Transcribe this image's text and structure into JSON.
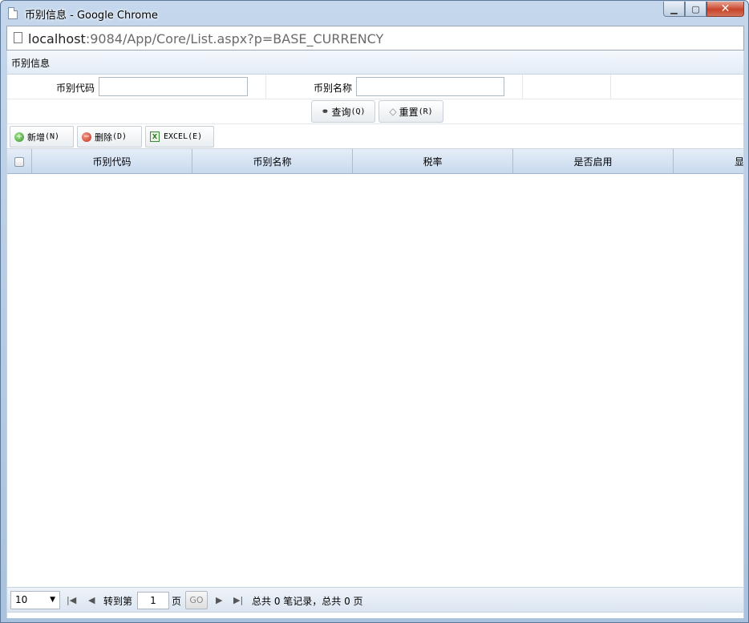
{
  "window": {
    "title": "币别信息 - Google Chrome",
    "controls": {
      "minimize": "▁",
      "restore": "▢",
      "close": "✕"
    }
  },
  "address": {
    "host": "localhost",
    "rest": ":9084/App/Core/List.aspx?p=BASE_CURRENCY"
  },
  "panel": {
    "title": "币别信息"
  },
  "search": {
    "code_label": "币别代码",
    "code_value": "",
    "name_label": "币别名称",
    "name_value": ""
  },
  "actions": {
    "query_label": "查询",
    "query_hotkey": "(Q)",
    "reset_label": "重置",
    "reset_hotkey": "(R)"
  },
  "toolbar": {
    "add_label": "新增",
    "add_hotkey": "(N)",
    "delete_label": "删除",
    "delete_hotkey": "(D)",
    "excel_label": "EXCEL",
    "excel_hotkey": "(E)"
  },
  "grid": {
    "columns": [
      "币别代码",
      "币别名称",
      "税率",
      "是否启用",
      "显"
    ],
    "rows": []
  },
  "pager": {
    "page_size": "10",
    "goto_label": "转到第",
    "page_value": "1",
    "page_unit": "页",
    "go_label": "GO",
    "summary": "总共 0 笔记录，总共 0 页"
  },
  "icons": {
    "first": "first-page-icon",
    "prev": "prev-page-icon",
    "next": "next-page-icon",
    "last": "last-page-icon"
  },
  "colors": {
    "header_gradient": "#c8d9ee",
    "close_button": "#c7452c",
    "add_icon": "#3a9a2a",
    "delete_icon": "#c62e1e"
  }
}
